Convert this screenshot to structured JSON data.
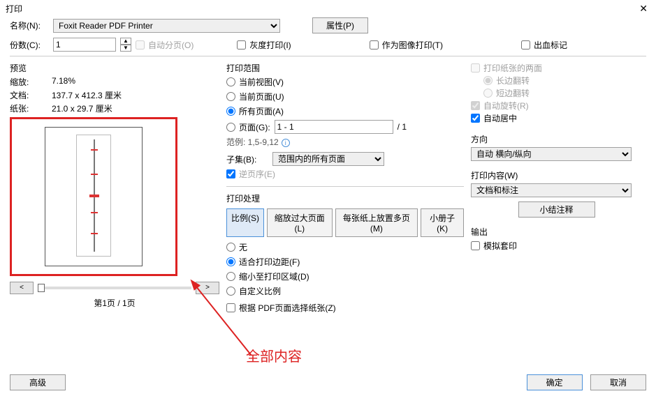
{
  "window": {
    "title": "打印"
  },
  "top": {
    "name_label": "名称(N):",
    "printer": "Foxit Reader PDF Printer",
    "properties_btn": "属性(P)",
    "copies_label": "份数(C):",
    "copies_value": "1",
    "collate": "自动分页(O)",
    "grayscale": "灰度打印(I)",
    "as_image": "作为图像打印(T)",
    "bleed": "出血标记"
  },
  "preview": {
    "title": "预览",
    "zoom_label": "缩放:",
    "zoom_value": "7.18%",
    "doc_label": "文档:",
    "doc_value": "137.7 x 412.3 厘米",
    "paper_label": "纸张:",
    "paper_value": "21.0 x 29.7 厘米",
    "page_counter": "第1页 / 1页"
  },
  "range": {
    "title": "打印范围",
    "current_view": "当前视图(V)",
    "current_page": "当前页面(U)",
    "all_pages": "所有页面(A)",
    "pages_label": "页面(G):",
    "pages_value": "1 - 1",
    "total_pages": "/ 1",
    "hint": "范例: 1,5-9,12",
    "subset_label": "子集(B):",
    "subset_value": "范围内的所有页面",
    "reverse": "逆页序(E)"
  },
  "handling": {
    "title": "打印处理",
    "scale": "比例(S)",
    "oversize": "缩放过大页面(L)",
    "multi": "每张纸上放置多页(M)",
    "booklet": "小册子(K)",
    "none": "无",
    "fit": "适合打印边距(F)",
    "shrink": "缩小至打印区域(D)",
    "custom": "自定义比例",
    "choose_by_page": "根据 PDF页面选择纸张(Z)"
  },
  "duplex": {
    "both_sides": "打印纸张的两面",
    "long_edge": "长边翻转",
    "short_edge": "短边翻转",
    "auto_rotate": "自动旋转(R)",
    "auto_center": "自动居中"
  },
  "orientation": {
    "title": "方向",
    "value": "自动 横向/纵向"
  },
  "content": {
    "title": "打印内容(W)",
    "value": "文档和标注",
    "summarize": "小结注释"
  },
  "output": {
    "title": "输出",
    "simulate": "模拟套印"
  },
  "buttons": {
    "advanced": "高级",
    "ok": "确定",
    "cancel": "取消"
  },
  "annotation": "全部内容"
}
